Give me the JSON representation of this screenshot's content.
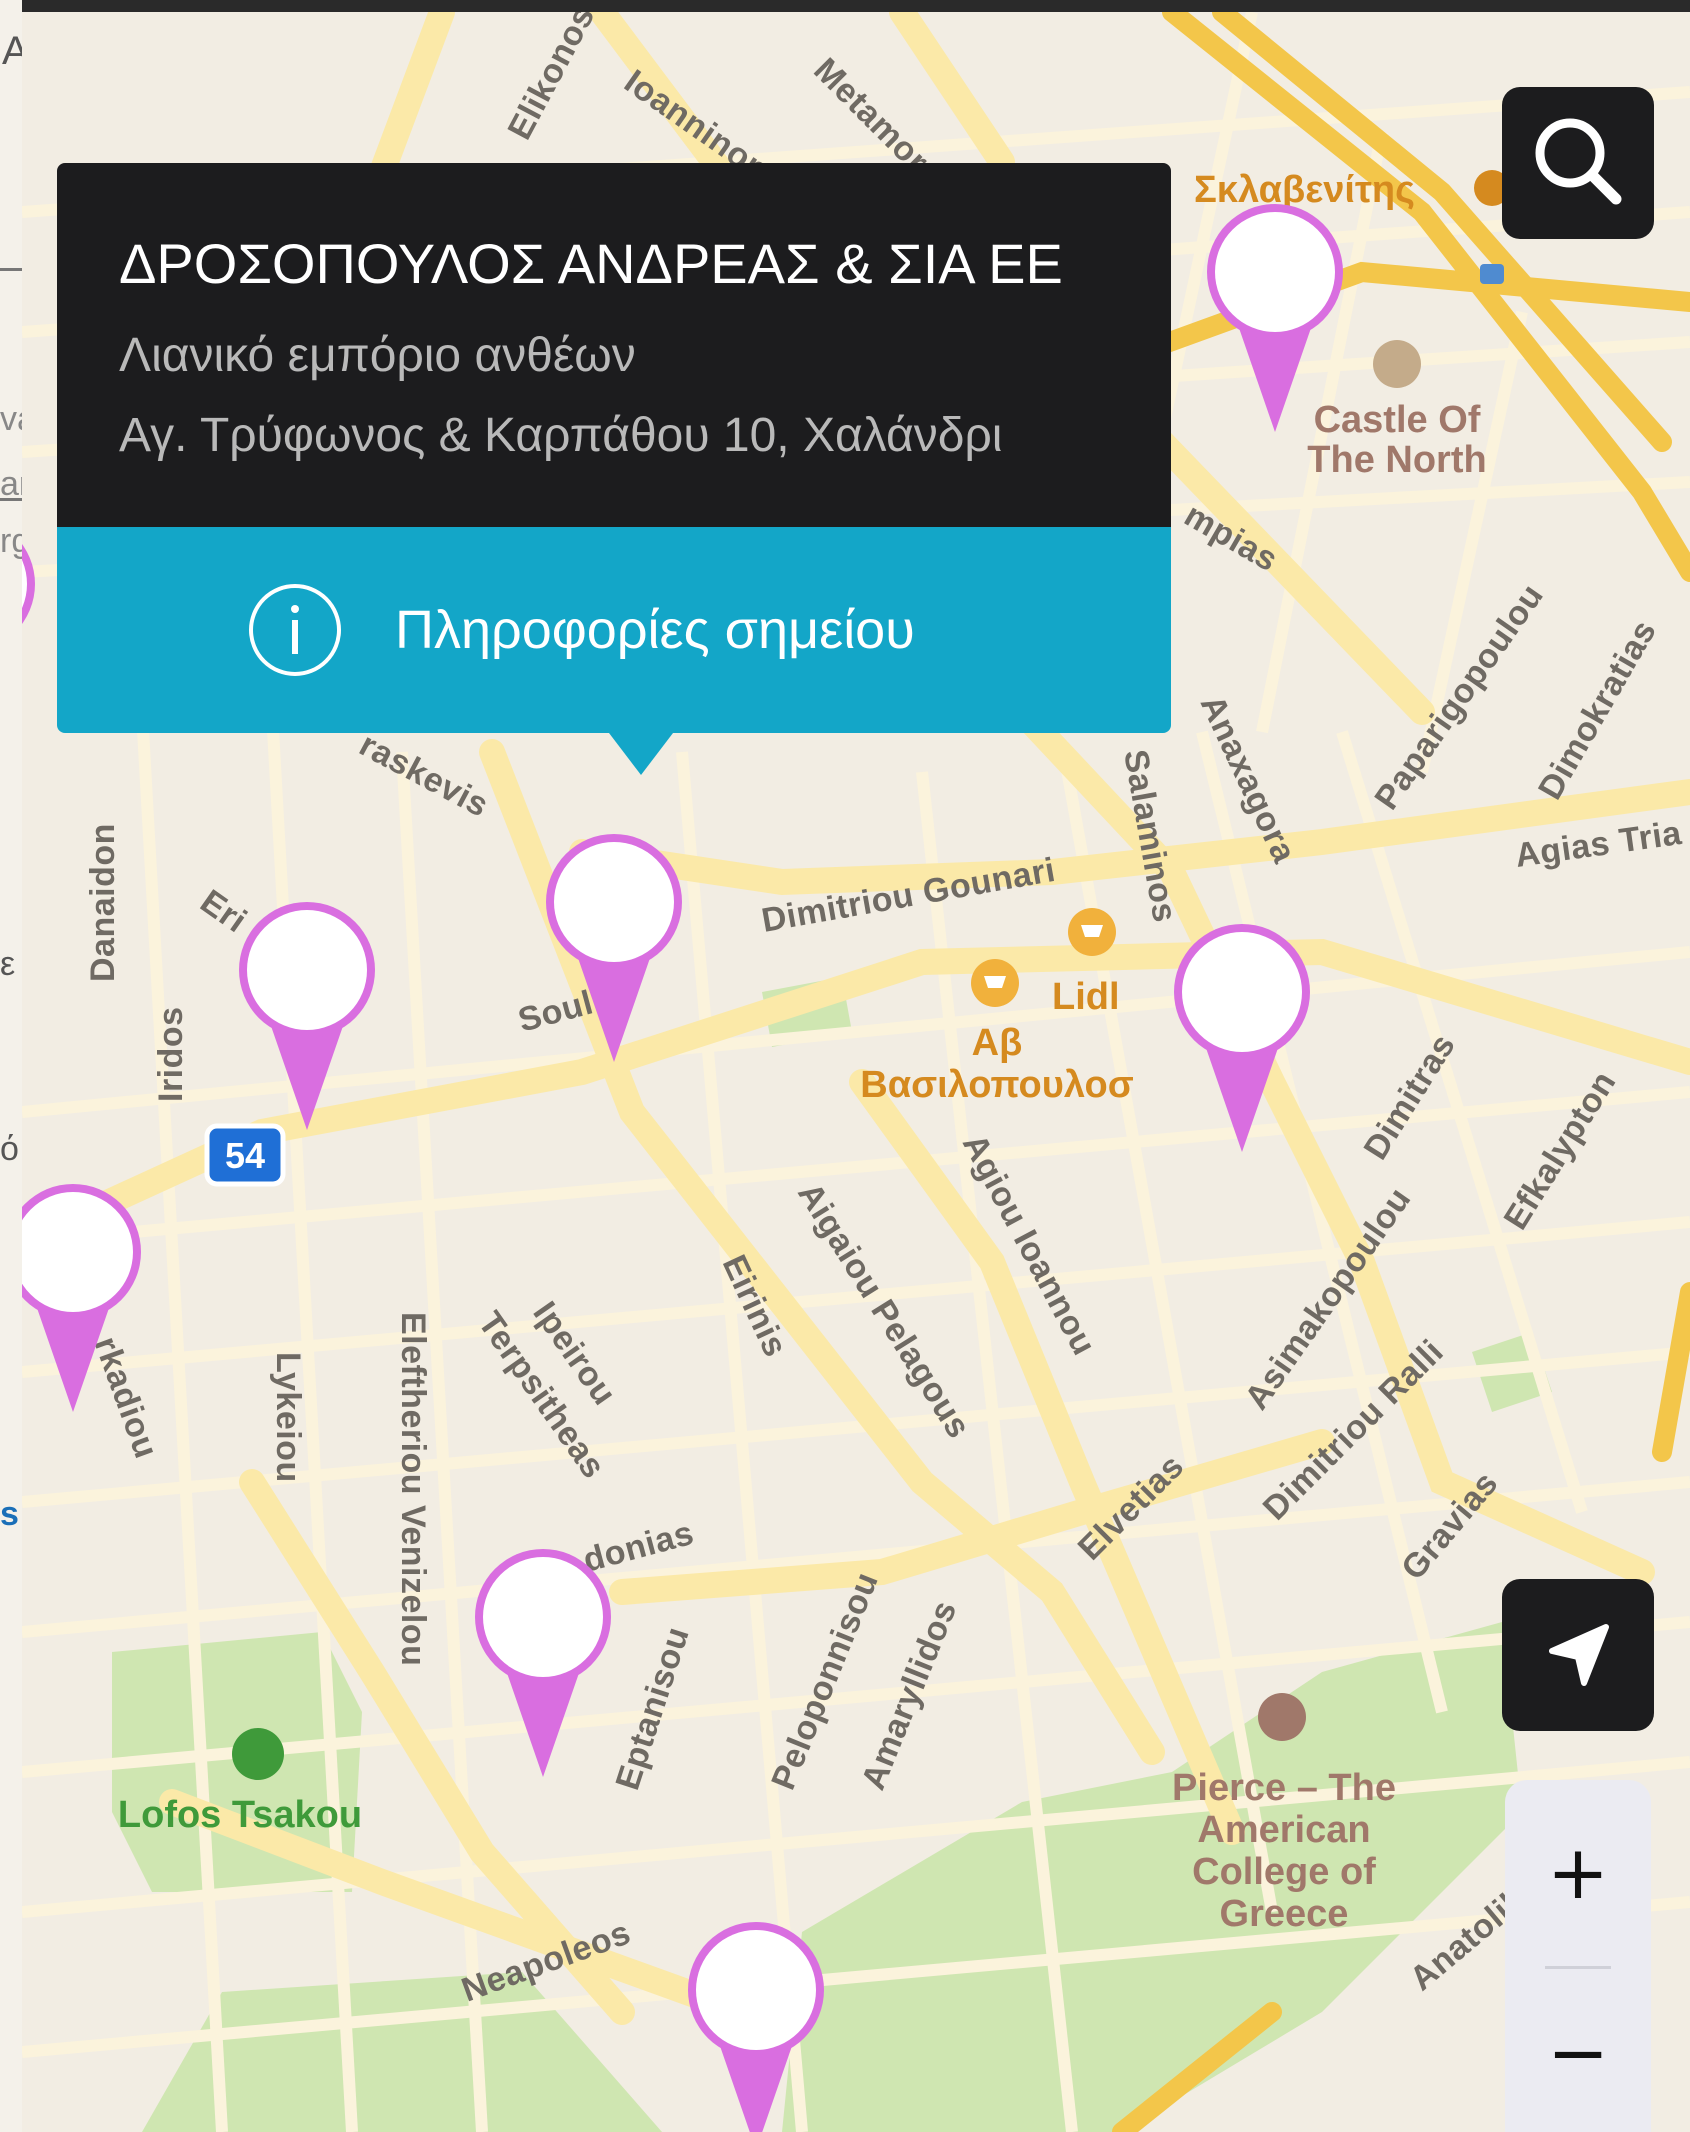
{
  "map": {
    "streets": [
      "Elikonos",
      "Ioanninon",
      "Metamor",
      "Dimitriou Gounari",
      "Salaminos",
      "Anaxagora",
      "Paparigopoulou",
      "Dimokratias",
      "Agias Tria",
      "raskevis",
      "Danaidon",
      "Iridos",
      "Soul",
      "Aigaiou Pelagous",
      "Eirinis",
      "Agiou Ioannou",
      "Ipeirou",
      "Terpsitheas",
      "Eleftheriou Venizelou",
      "Lykeiou",
      "rkadiou",
      "Dimitras",
      "Efkalypton",
      "Asimakopoulou",
      "Dimitriou Ralli",
      "Gravias",
      "Elvetias",
      "donias",
      "Eptanisou",
      "Peloponnisou",
      "Amaryllidos",
      "Neapoleos",
      "Anatolik",
      "mpias",
      "Eri"
    ],
    "pois": {
      "sklavenitis": "Σκλαβενίτης",
      "castle_line1": "Castle Of",
      "castle_line2": "The North",
      "lidl": "Lidl",
      "ab_line1": "Αβ",
      "ab_line2": "Βασιλοπουλοσ",
      "pierce_line1": "Pierce – The",
      "pierce_line2": "American",
      "pierce_line3": "College of",
      "pierce_line4": "Greece",
      "lofos": "Lofos Tsakou"
    },
    "route_shield": "54",
    "colors": {
      "land": "#f2ede3",
      "road": "#fbe9a8",
      "highway": "#f3c64a",
      "park": "#cfe6b1",
      "pin": "#d96ee0"
    }
  },
  "popup": {
    "title": "ΔΡΟΣΟΠΟΥΛΟΣ ΑΝΔΡΕΑΣ & ΣΙΑ ΕΕ",
    "category": "Λιανικό εμπόριο ανθέων",
    "address": "Αγ. Τρύφωνος & Καρπάθου 10, Χαλάνδρι",
    "button_label": "Πληροφορίες σημείου",
    "button_color": "#13a6c8"
  },
  "controls": {
    "search_icon": "search-icon",
    "locate_icon": "location-arrow-icon",
    "zoom_in": "+",
    "zoom_out": "−"
  },
  "left_strip_fragments": [
    "A",
    "va",
    "an",
    "rgi",
    "ε",
    "ό",
    "s;"
  ]
}
